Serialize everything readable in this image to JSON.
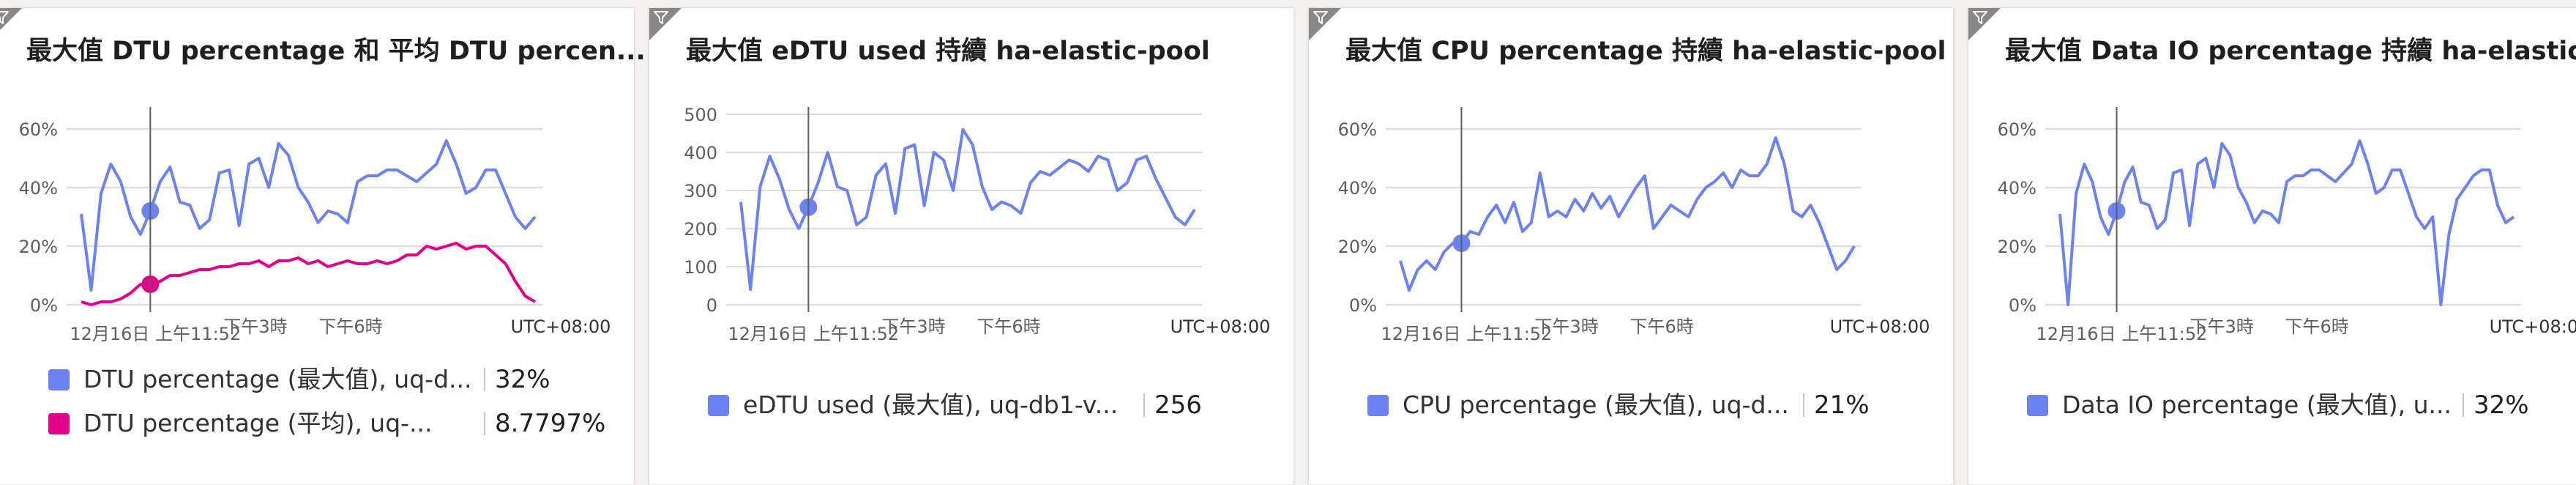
{
  "tiles": [
    {
      "title": "最大值 DTU percentage 和 平均 DTU percen...",
      "legend": [
        {
          "label": "DTU percentage (最大值), uq-d...",
          "value": "32%",
          "color": "#6b82f2"
        },
        {
          "label": "DTU percentage (平均), uq-...",
          "value": "8.7797%",
          "color": "#e3008c"
        }
      ],
      "chart_data": {
        "type": "line",
        "yticks": [
          "60%",
          "40%",
          "20%",
          "0%"
        ],
        "ylim": [
          0,
          65
        ],
        "xticks": [
          "12月16日 上午11:52",
          "下午3時",
          "下午6時"
        ],
        "timezone": "UTC+08:00",
        "cursor_index": 7,
        "series": [
          {
            "color": "#6b82f2",
            "values": [
              31,
              5,
              38,
              48,
              42,
              30,
              24,
              32,
              42,
              47,
              35,
              34,
              26,
              29,
              45,
              46,
              27,
              48,
              50,
              40,
              55,
              51,
              40,
              35,
              28,
              32,
              31,
              28,
              42,
              44,
              44,
              46,
              46,
              44,
              42,
              45,
              48,
              56,
              48,
              38,
              40,
              46,
              46,
              38,
              30,
              26,
              30
            ]
          },
          {
            "color": "#e3008c",
            "values": [
              1,
              0,
              1,
              1,
              2,
              4,
              7,
              7,
              8,
              10,
              10,
              11,
              12,
              12,
              13,
              13,
              14,
              14,
              15,
              13,
              15,
              15,
              16,
              14,
              15,
              13,
              14,
              15,
              14,
              14,
              15,
              14,
              15,
              17,
              17,
              20,
              19,
              20,
              21,
              19,
              20,
              20,
              17,
              14,
              8,
              3,
              1
            ]
          }
        ]
      }
    },
    {
      "title": "最大值 eDTU used 持續 ha-elastic-pool",
      "legend": [
        {
          "label": "eDTU used (最大值), uq-db1-v...",
          "value": "256",
          "color": "#6b82f2"
        }
      ],
      "chart_data": {
        "type": "line",
        "yticks": [
          "500",
          "400",
          "300",
          "200",
          "100",
          "0"
        ],
        "ylim": [
          0,
          500
        ],
        "xticks": [
          "12月16日 上午11:52",
          "下午3時",
          "下午6時"
        ],
        "timezone": "UTC+08:00",
        "cursor_index": 7,
        "series": [
          {
            "color": "#6b82f2",
            "values": [
              270,
              40,
              310,
              390,
              330,
              250,
              200,
              256,
              320,
              400,
              310,
              300,
              210,
              230,
              340,
              370,
              240,
              410,
              420,
              260,
              400,
              380,
              300,
              460,
              420,
              310,
              250,
              270,
              260,
              240,
              320,
              350,
              340,
              360,
              380,
              370,
              350,
              390,
              380,
              300,
              320,
              380,
              390,
              330,
              280,
              230,
              210,
              250
            ]
          }
        ]
      }
    },
    {
      "title": "最大值 CPU percentage 持續 ha-elastic-pool",
      "legend": [
        {
          "label": "CPU percentage (最大值), uq-d...",
          "value": "21%",
          "color": "#6b82f2"
        }
      ],
      "chart_data": {
        "type": "line",
        "yticks": [
          "60%",
          "40%",
          "20%",
          "0%"
        ],
        "ylim": [
          0,
          65
        ],
        "xticks": [
          "12月16日 上午11:52",
          "下午3時",
          "下午6時"
        ],
        "timezone": "UTC+08:00",
        "cursor_index": 7,
        "series": [
          {
            "color": "#6b82f2",
            "values": [
              15,
              5,
              12,
              15,
              12,
              18,
              21,
              21,
              25,
              24,
              30,
              34,
              28,
              35,
              25,
              28,
              45,
              30,
              32,
              30,
              36,
              32,
              38,
              33,
              37,
              30,
              35,
              40,
              44,
              26,
              30,
              34,
              32,
              30,
              36,
              40,
              42,
              45,
              40,
              46,
              44,
              44,
              48,
              57,
              48,
              32,
              30,
              34,
              28,
              20,
              12,
              15,
              20
            ]
          }
        ]
      }
    },
    {
      "title": "最大值 Data IO percentage 持續 ha-elastic-...",
      "legend": [
        {
          "label": "Data IO percentage (最大值), u...",
          "value": "32%",
          "color": "#6b82f2"
        }
      ],
      "chart_data": {
        "type": "line",
        "yticks": [
          "60%",
          "40%",
          "20%",
          "0%"
        ],
        "ylim": [
          0,
          65
        ],
        "xticks": [
          "12月16日 上午11:52",
          "下午3時",
          "下午6時"
        ],
        "timezone": "UTC+08:00",
        "cursor_index": 7,
        "series": [
          {
            "color": "#6b82f2",
            "values": [
              31,
              0,
              38,
              48,
              42,
              30,
              24,
              32,
              42,
              47,
              35,
              34,
              26,
              29,
              45,
              46,
              27,
              48,
              50,
              40,
              55,
              51,
              40,
              35,
              28,
              32,
              31,
              28,
              42,
              44,
              44,
              46,
              46,
              44,
              42,
              45,
              48,
              56,
              48,
              38,
              40,
              46,
              46,
              38,
              30,
              26,
              30,
              0,
              24,
              36,
              40,
              44,
              46,
              46,
              34,
              28,
              30
            ]
          }
        ]
      }
    }
  ]
}
